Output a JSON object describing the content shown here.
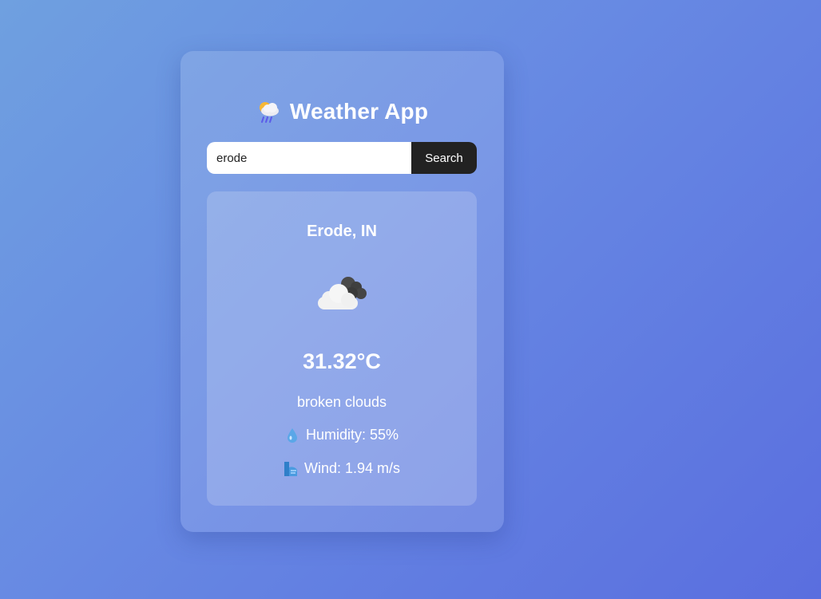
{
  "app": {
    "title": "Weather App",
    "title_icon": "sun-cloud-rain-icon"
  },
  "search": {
    "value": "erode",
    "placeholder": "",
    "button_label": "Search"
  },
  "weather": {
    "city": "Erode, IN",
    "icon": "broken-clouds-icon",
    "temperature": "31.32°C",
    "description": "broken clouds",
    "humidity_label": "Humidity: 55%",
    "humidity_icon": "droplet-icon",
    "wind_label": "Wind: 1.94 m/s",
    "wind_icon": "wind-icon"
  },
  "colors": {
    "background_start": "#6fa0e0",
    "background_end": "#5a6edf",
    "button": "#222222",
    "text": "#ffffff"
  }
}
